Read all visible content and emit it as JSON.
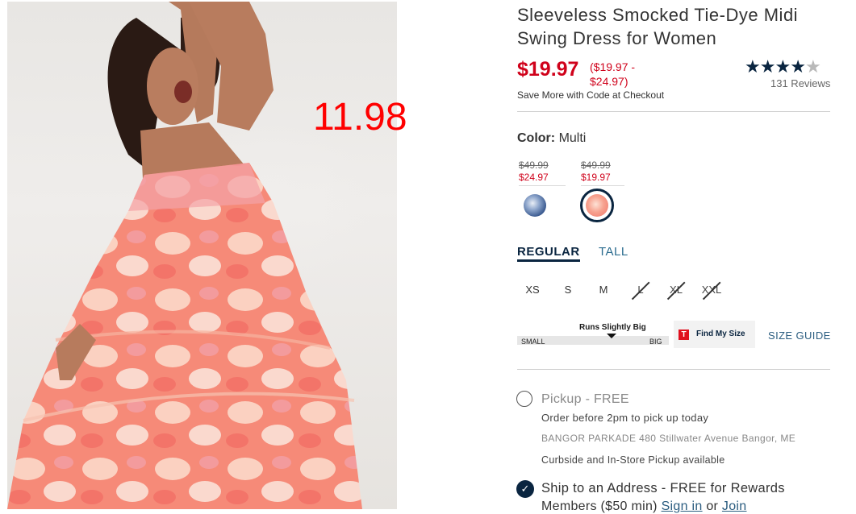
{
  "overlay": {
    "price_note": "11.98"
  },
  "product": {
    "title": "Sleeveless Smocked Tie-Dye Midi Swing Dress for Women",
    "price": "$19.97",
    "price_range": "($19.97 - $24.97)",
    "promo": "Save More with Code at Checkout",
    "rating_value": 4.5,
    "rating_max": 5,
    "reviews": "131 Reviews"
  },
  "color": {
    "label": "Color:",
    "value": "Multi",
    "swatches": [
      {
        "old": "$49.99",
        "new": "$24.97",
        "icon": "blue-tie-dye-swatch",
        "selected": false
      },
      {
        "old": "$49.99",
        "new": "$19.97",
        "icon": "pink-tie-dye-swatch",
        "selected": true
      }
    ]
  },
  "fit_tabs": {
    "regular": "REGULAR",
    "tall": "TALL",
    "selected": "REGULAR"
  },
  "sizes": [
    {
      "label": "XS",
      "available": true
    },
    {
      "label": "S",
      "available": true
    },
    {
      "label": "M",
      "available": true
    },
    {
      "label": "L",
      "available": false
    },
    {
      "label": "XL",
      "available": false
    },
    {
      "label": "XXL",
      "available": false
    }
  ],
  "fit_scale": {
    "title": "Runs Slightly Big",
    "small": "SMALL",
    "big": "BIG"
  },
  "find_my_size": {
    "icon_letter": "T",
    "label": "Find My Size"
  },
  "size_guide": "SIZE GUIDE",
  "pickup": {
    "title": "Pickup - FREE",
    "sub": "Order before 2pm to pick up today",
    "store": "BANGOR PARKADE 480 Stillwater Avenue  Bangor, ME",
    "curbside": "Curbside and In-Store Pickup available"
  },
  "ship": {
    "title": "Ship to an Address - FREE for Rewards",
    "line2_prefix": "Members ($50 min) ",
    "sign_in": "Sign in",
    "or": " or ",
    "join": "Join"
  },
  "colors": {
    "accent": "#0a2540",
    "sale": "#d0021b",
    "overlay": "#ff0000"
  }
}
